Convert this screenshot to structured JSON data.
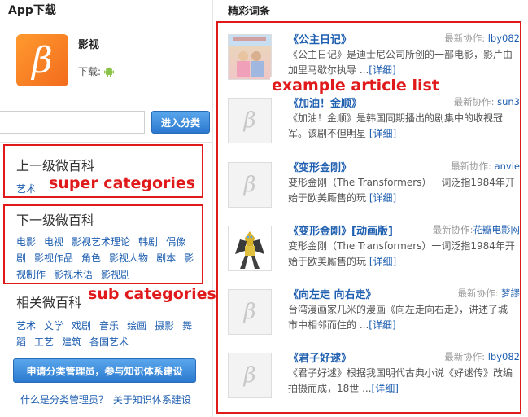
{
  "left": {
    "section_title": "App下载",
    "app": {
      "name": "影视",
      "download_label": "下载:"
    },
    "search": {
      "button": "进入分类"
    },
    "super": {
      "title": "上一级微百科",
      "links": [
        "艺术"
      ]
    },
    "sub": {
      "title": "下一级微百科",
      "links": [
        "电影",
        "电视",
        "影视艺术理论",
        "韩剧",
        "偶像剧",
        "影视作品",
        "角色",
        "影视人物",
        "剧本",
        "影视制作",
        "影视术语",
        "影视剧"
      ]
    },
    "related": {
      "title": "相关微百科",
      "links": [
        "艺术",
        "文学",
        "戏剧",
        "音乐",
        "绘画",
        "摄影",
        "舞蹈",
        "工艺",
        "建筑",
        "各国艺术"
      ]
    },
    "admin_button": "申请分类管理员，参与知识体系建设",
    "footer": [
      "什么是分类管理员？",
      "关于知识体系建设"
    ]
  },
  "right": {
    "title": "精彩词条",
    "articles": [
      {
        "title": "《公主日记》",
        "meta_label": "最新协作:",
        "user": "lby082",
        "desc": "《公主日记》是迪士尼公司所创的一部电影，影片由加里马歇尔执导",
        "more": "[详细]",
        "thumb": "poster"
      },
      {
        "title": "《加油！金顺》",
        "meta_label": "最新协作:",
        "user": "sun3",
        "desc": "《加油！金顺》是韩国同期播出的剧集中的收视冠军。该剧不但明星",
        "more": "[详细]",
        "thumb": "placeholder"
      },
      {
        "title": "《变形金刚》",
        "meta_label": "最新协作:",
        "user": "anvie",
        "desc": "变形金刚（The Transformers）一词泛指1984年开始于欧美厮售的玩",
        "more": "[详细]",
        "thumb": "placeholder"
      },
      {
        "title": "《变形金刚》[动画版]",
        "meta_label": "最新协作:",
        "user": "花瓣电影网",
        "desc": "变形金刚（The Transformers）一词泛指1984年开始于欧美厮售的玩",
        "more": "[详细]",
        "thumb": "robot"
      },
      {
        "title": "《向左走 向右走》",
        "meta_label": "最新协作:",
        "user": "梦謬",
        "desc": "台湾漫画家几米的漫画《向左走向右走》，讲述了城市中相邻而住的",
        "more": "[详细]",
        "thumb": "placeholder"
      },
      {
        "title": "《君子好逑》",
        "meta_label": "最新协作:",
        "user": "lby082",
        "desc": "《君子好逑》根据我国明代古典小说《好逑传》改编拍摄而成，18世",
        "more": "[详细]",
        "thumb": "placeholder"
      }
    ]
  },
  "annotations": {
    "article_list": "example article list",
    "super": "super categories",
    "sub": "sub categories"
  },
  "colors": {
    "annotation": "#e0191b",
    "link": "#1f5fb0",
    "accent": "#2b79d0"
  }
}
